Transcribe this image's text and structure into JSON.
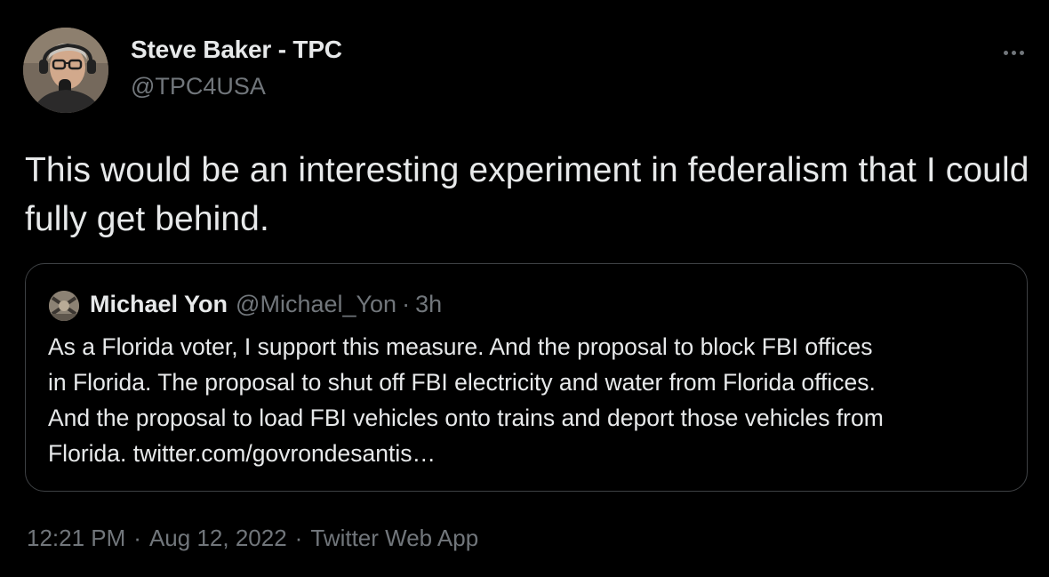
{
  "author": {
    "name": "Steve Baker - TPC",
    "handle": "@TPC4USA"
  },
  "tweet": {
    "text": "This would be an interesting experiment in federalism that I could fully get behind."
  },
  "quoted_tweet": {
    "name": "Michael Yon",
    "handle": "@Michael_Yon",
    "separator": "·",
    "time": "3h",
    "lines": [
      "As a Florida voter, I support this measure.  And the proposal to block FBI offices",
      "in Florida.  The proposal to shut off FBI electricity and water from Florida offices.",
      "And the proposal to load FBI vehicles onto trains and deport those vehicles from",
      "Florida. twitter.com/govrondesantis…"
    ]
  },
  "meta": {
    "time": "12:21 PM",
    "separator": "·",
    "date": "Aug 12, 2022",
    "source": "Twitter Web App"
  },
  "icons": {
    "more": "more-horizontal-icon"
  },
  "colors": {
    "background": "#000000",
    "primary_text": "#e7e9ea",
    "secondary_text": "#71767b",
    "border": "#3e4144"
  }
}
